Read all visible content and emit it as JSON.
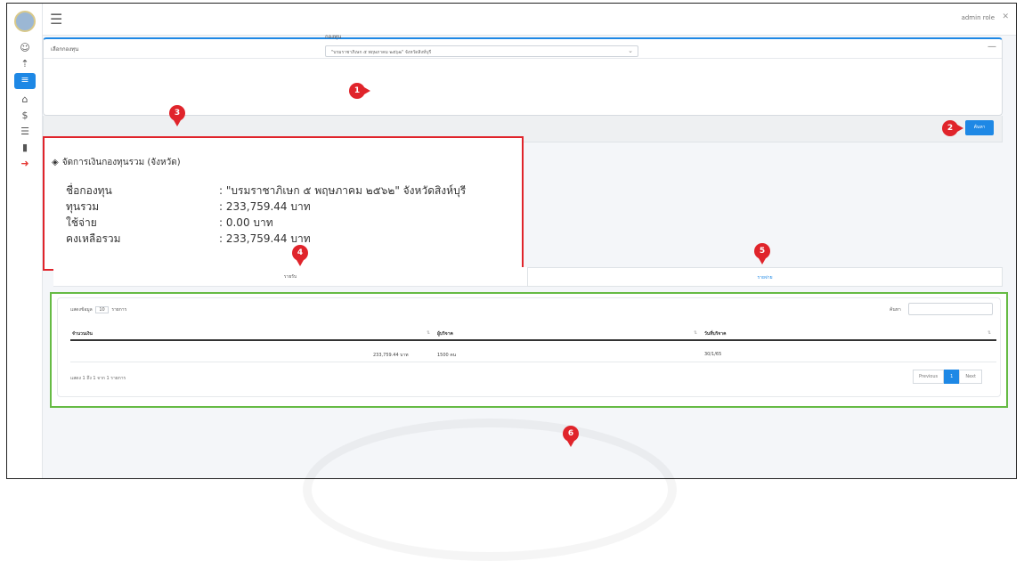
{
  "topbar": {
    "user": "admin role",
    "close": "✕"
  },
  "card": {
    "header": "เลือกกองทุน",
    "collapse": "—",
    "fund_label": "กองทุน",
    "fund_value": "\"บรมราชาภิเษก ๕ พฤษภาคม ๒๕๖๒\" จังหวัดสิงห์บุรี",
    "search_button": "ค้นหา"
  },
  "summary": {
    "title": "จัดการเงินกองทุนรวม (จังหวัด)",
    "rows": [
      {
        "label": "ชื่อกองทุน",
        "value": ": \"บรมราชาภิเษก ๕ พฤษภาคม ๒๕๖๒\" จังหวัดสิงห์บุรี"
      },
      {
        "label": "ทุนรวม",
        "value": ": 233,759.44 บาท"
      },
      {
        "label": "ใช้จ่าย",
        "value": ": 0.00 บาท"
      },
      {
        "label": "คงเหลือรวม",
        "value": ": 233,759.44 บาท"
      }
    ]
  },
  "tabs": {
    "income": "รายรับ",
    "expense": "รายจ่าย"
  },
  "table": {
    "show_prefix": "แสดงข้อมูล",
    "entries": "10",
    "show_suffix": "รายการ",
    "search_label": "ค้นหา",
    "columns": [
      "จำนวนเงิน",
      "ผู้บริจาค",
      "วันที่บริจาค"
    ],
    "rows": [
      {
        "amount": "233,759.44 บาท",
        "donor": "1500 คน",
        "date": "30/1/65"
      }
    ],
    "info": "แสดง 1 ถึง 1 จาก 1 รายการ",
    "prev": "Previous",
    "page": "1",
    "next": "Next"
  },
  "markers": [
    "1",
    "2",
    "3",
    "4",
    "5",
    "6"
  ],
  "colors": {
    "accent": "#1e88e5",
    "marker": "#e0242b",
    "highlight_red": "#e0242b",
    "highlight_green": "#66bb44"
  }
}
